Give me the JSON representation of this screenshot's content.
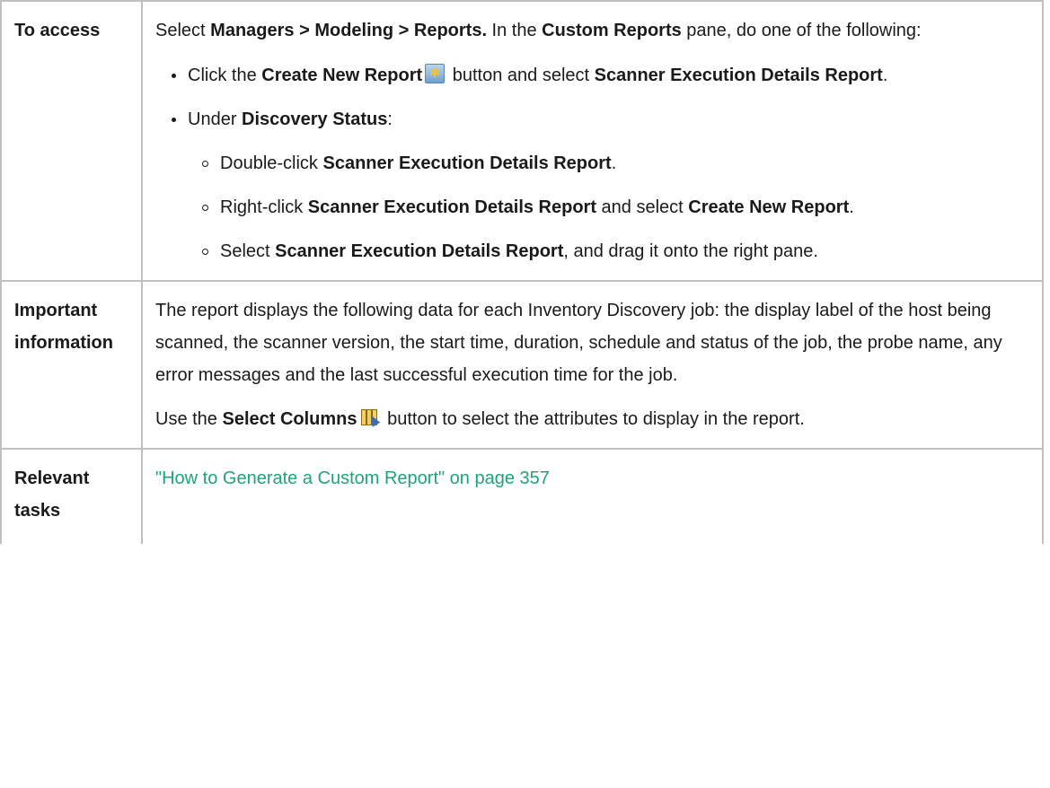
{
  "rows": {
    "access": {
      "label": "To access",
      "intro": {
        "t1": "Select ",
        "b1": "Managers > Modeling > Reports.",
        "t2": " In the ",
        "b2": "Custom Reports",
        "t3": " pane, do one of the following:"
      },
      "bullet1": {
        "t1": "Click the ",
        "b1": "Create New Report",
        "icon": "create-new-report-icon",
        "t2": " button and select ",
        "b2": "Scanner Execution Details Report",
        "t3": "."
      },
      "bullet2": {
        "t1": "Under ",
        "b1": "Discovery Status",
        "t2": ":",
        "sub1": {
          "t1": "Double-click ",
          "b1": "Scanner Execution Details Report",
          "t2": "."
        },
        "sub2": {
          "t1": "Right-click ",
          "b1": "Scanner Execution Details Report",
          "t2": " and select ",
          "b2": "Create New Report",
          "t3": "."
        },
        "sub3": {
          "t1": "Select ",
          "b1": "Scanner Execution Details Report",
          "t2": ", and drag it onto the right pane."
        }
      }
    },
    "important": {
      "label": "Important information",
      "para1": "The report displays the following data for each Inventory Discovery job: the display label of the host being scanned, the scanner version, the start time, duration, schedule and status of the job, the probe name, any error messages and the last successful execution time for the job.",
      "para2": {
        "t1": "Use the ",
        "b1": "Select Columns",
        "icon": "select-columns-icon",
        "t2": " button to select the attributes to display in the report."
      }
    },
    "tasks": {
      "label": "Relevant tasks",
      "link": "\"How to Generate a Custom Report\" on page 357",
      "link_color": "#1fa37a"
    }
  }
}
